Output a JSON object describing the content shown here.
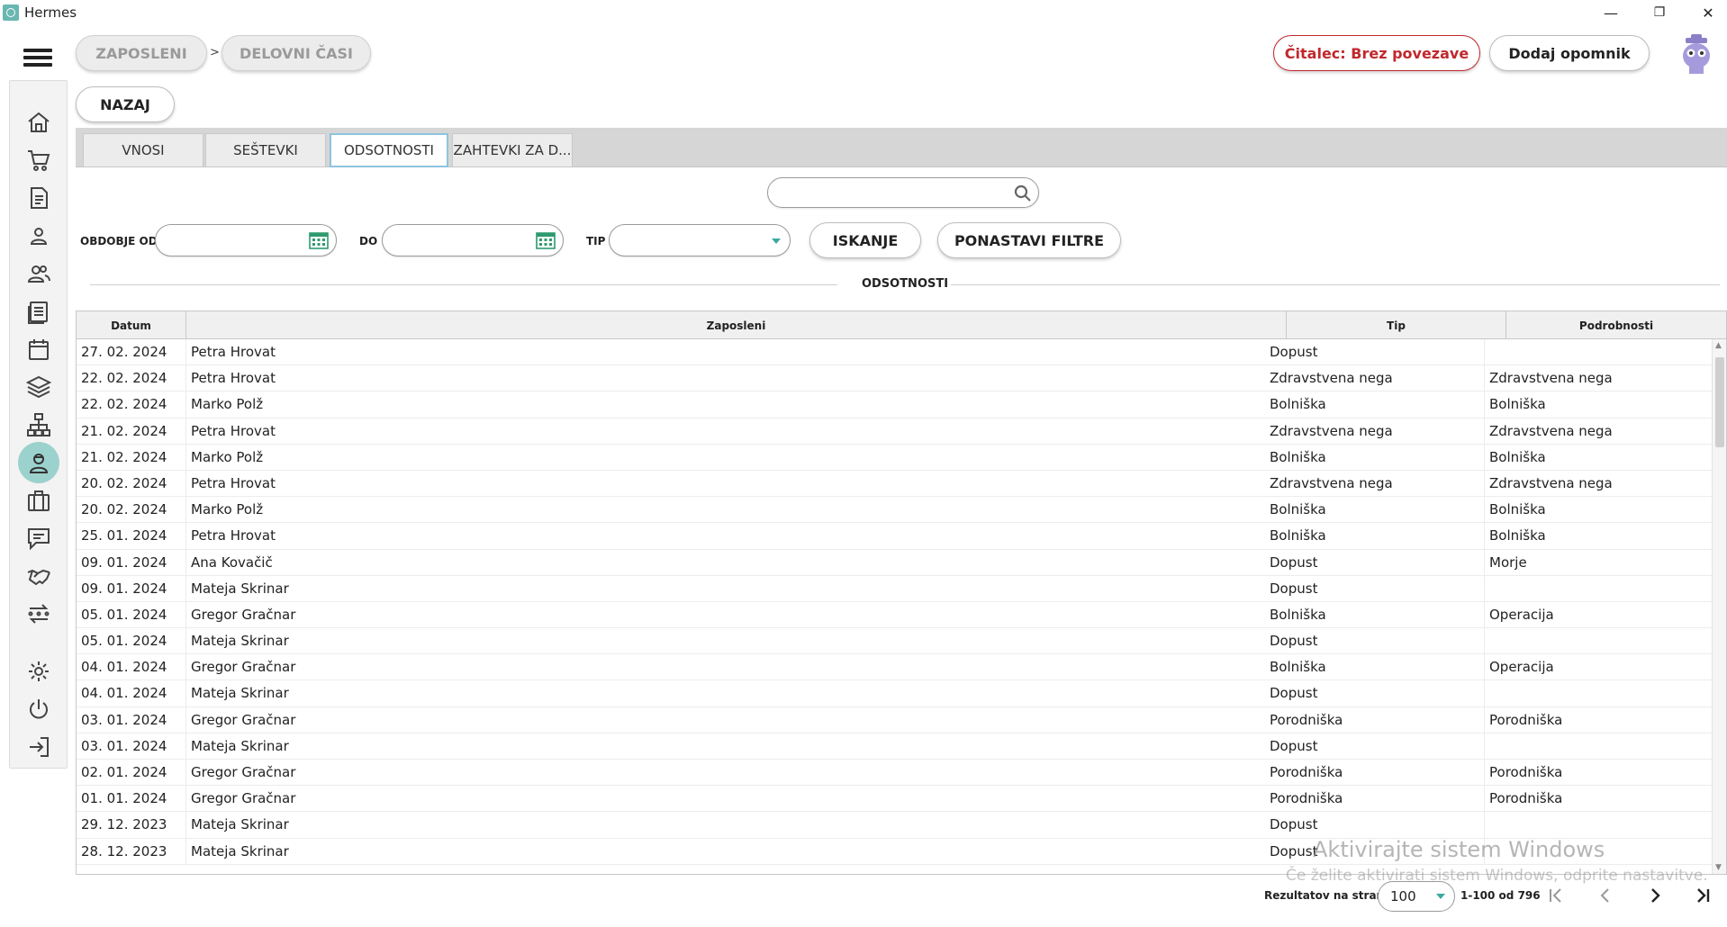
{
  "window": {
    "title": "Hermes",
    "minimize": "—",
    "restore": "❐",
    "close": "✕"
  },
  "breadcrumb": {
    "items": [
      "ZAPOSLENI",
      "DELOVNI ČASI"
    ],
    "separator": ">"
  },
  "header": {
    "reader_status": "Čitalec: Brez povezave",
    "add_reminder": "Dodaj opomnik",
    "back": "NAZAJ"
  },
  "sidebar": {
    "items": [
      {
        "icon": "home-icon"
      },
      {
        "icon": "cart-icon"
      },
      {
        "icon": "document-icon"
      },
      {
        "icon": "user-icon"
      },
      {
        "icon": "users-icon"
      },
      {
        "icon": "list-icon"
      },
      {
        "icon": "calendar-icon"
      },
      {
        "icon": "layers-icon"
      },
      {
        "icon": "hierarchy-icon"
      },
      {
        "icon": "employee-icon",
        "active": true
      },
      {
        "icon": "briefcase-icon"
      },
      {
        "icon": "message-icon"
      },
      {
        "icon": "handshake-icon"
      },
      {
        "icon": "transfer-icon"
      },
      {
        "icon": "gear-icon"
      },
      {
        "icon": "power-icon"
      },
      {
        "icon": "logout-icon"
      }
    ],
    "active_color": "#7fc7c0"
  },
  "tabs": [
    {
      "label": "VNOSI"
    },
    {
      "label": "SEŠTEVKI"
    },
    {
      "label": "ODSOTNOSTI",
      "active": true
    },
    {
      "label": "ZAHTEVKI ZA D..."
    }
  ],
  "search": {
    "value": ""
  },
  "filters": {
    "period_from_label": "OBDOBJE OD",
    "period_to_label": "DO",
    "type_label": "TIP",
    "search_button": "ISKANJE",
    "reset_button": "PONASTAVI FILTRE"
  },
  "section_title": "ODSOTNOSTI",
  "table": {
    "columns": [
      "Datum",
      "Zaposleni",
      "Tip",
      "Podrobnosti"
    ],
    "rows": [
      [
        "27. 02. 2024",
        "Petra Hrovat",
        "Dopust",
        ""
      ],
      [
        "22. 02. 2024",
        "Petra Hrovat",
        "Zdravstvena nega",
        "Zdravstvena nega"
      ],
      [
        "22. 02. 2024",
        "Marko Polž",
        "Bolniška",
        "Bolniška"
      ],
      [
        "21. 02. 2024",
        "Petra Hrovat",
        "Zdravstvena nega",
        "Zdravstvena nega"
      ],
      [
        "21. 02. 2024",
        "Marko Polž",
        "Bolniška",
        "Bolniška"
      ],
      [
        "20. 02. 2024",
        "Petra Hrovat",
        "Zdravstvena nega",
        "Zdravstvena nega"
      ],
      [
        "20. 02. 2024",
        "Marko Polž",
        "Bolniška",
        "Bolniška"
      ],
      [
        "25. 01. 2024",
        "Petra Hrovat",
        "Bolniška",
        "Bolniška"
      ],
      [
        "09. 01. 2024",
        "Ana Kovačič",
        "Dopust",
        "Morje"
      ],
      [
        "09. 01. 2024",
        "Mateja Skrinar",
        "Dopust",
        ""
      ],
      [
        "05. 01. 2024",
        "Gregor Gračnar",
        "Bolniška",
        "Operacija"
      ],
      [
        "05. 01. 2024",
        "Mateja Skrinar",
        "Dopust",
        ""
      ],
      [
        "04. 01. 2024",
        "Gregor Gračnar",
        "Bolniška",
        "Operacija"
      ],
      [
        "04. 01. 2024",
        "Mateja Skrinar",
        "Dopust",
        ""
      ],
      [
        "03. 01. 2024",
        "Gregor Gračnar",
        "Porodniška",
        "Porodniška"
      ],
      [
        "03. 01. 2024",
        "Mateja Skrinar",
        "Dopust",
        ""
      ],
      [
        "02. 01. 2024",
        "Gregor Gračnar",
        "Porodniška",
        "Porodniška"
      ],
      [
        "01. 01. 2024",
        "Gregor Gračnar",
        "Porodniška",
        "Porodniška"
      ],
      [
        "29. 12. 2023",
        "Mateja Skrinar",
        "Dopust",
        ""
      ],
      [
        "28. 12. 2023",
        "Mateja Skrinar",
        "Dopust",
        ""
      ]
    ]
  },
  "pagination": {
    "per_page_label": "Rezultatov na stran",
    "per_page_value": "100",
    "range_info": "1-100 od 796",
    "first": "|<",
    "prev": "‹",
    "next": "›",
    "last": ">|"
  },
  "watermark": {
    "line1": "Aktivirajte sistem Windows",
    "line2": "Če želite aktivirati sistem Windows, odprite nastavitve."
  },
  "colors": {
    "accent": "#3aa9a0",
    "danger": "#c0282d",
    "tab_active_border": "#8cc4e0"
  }
}
